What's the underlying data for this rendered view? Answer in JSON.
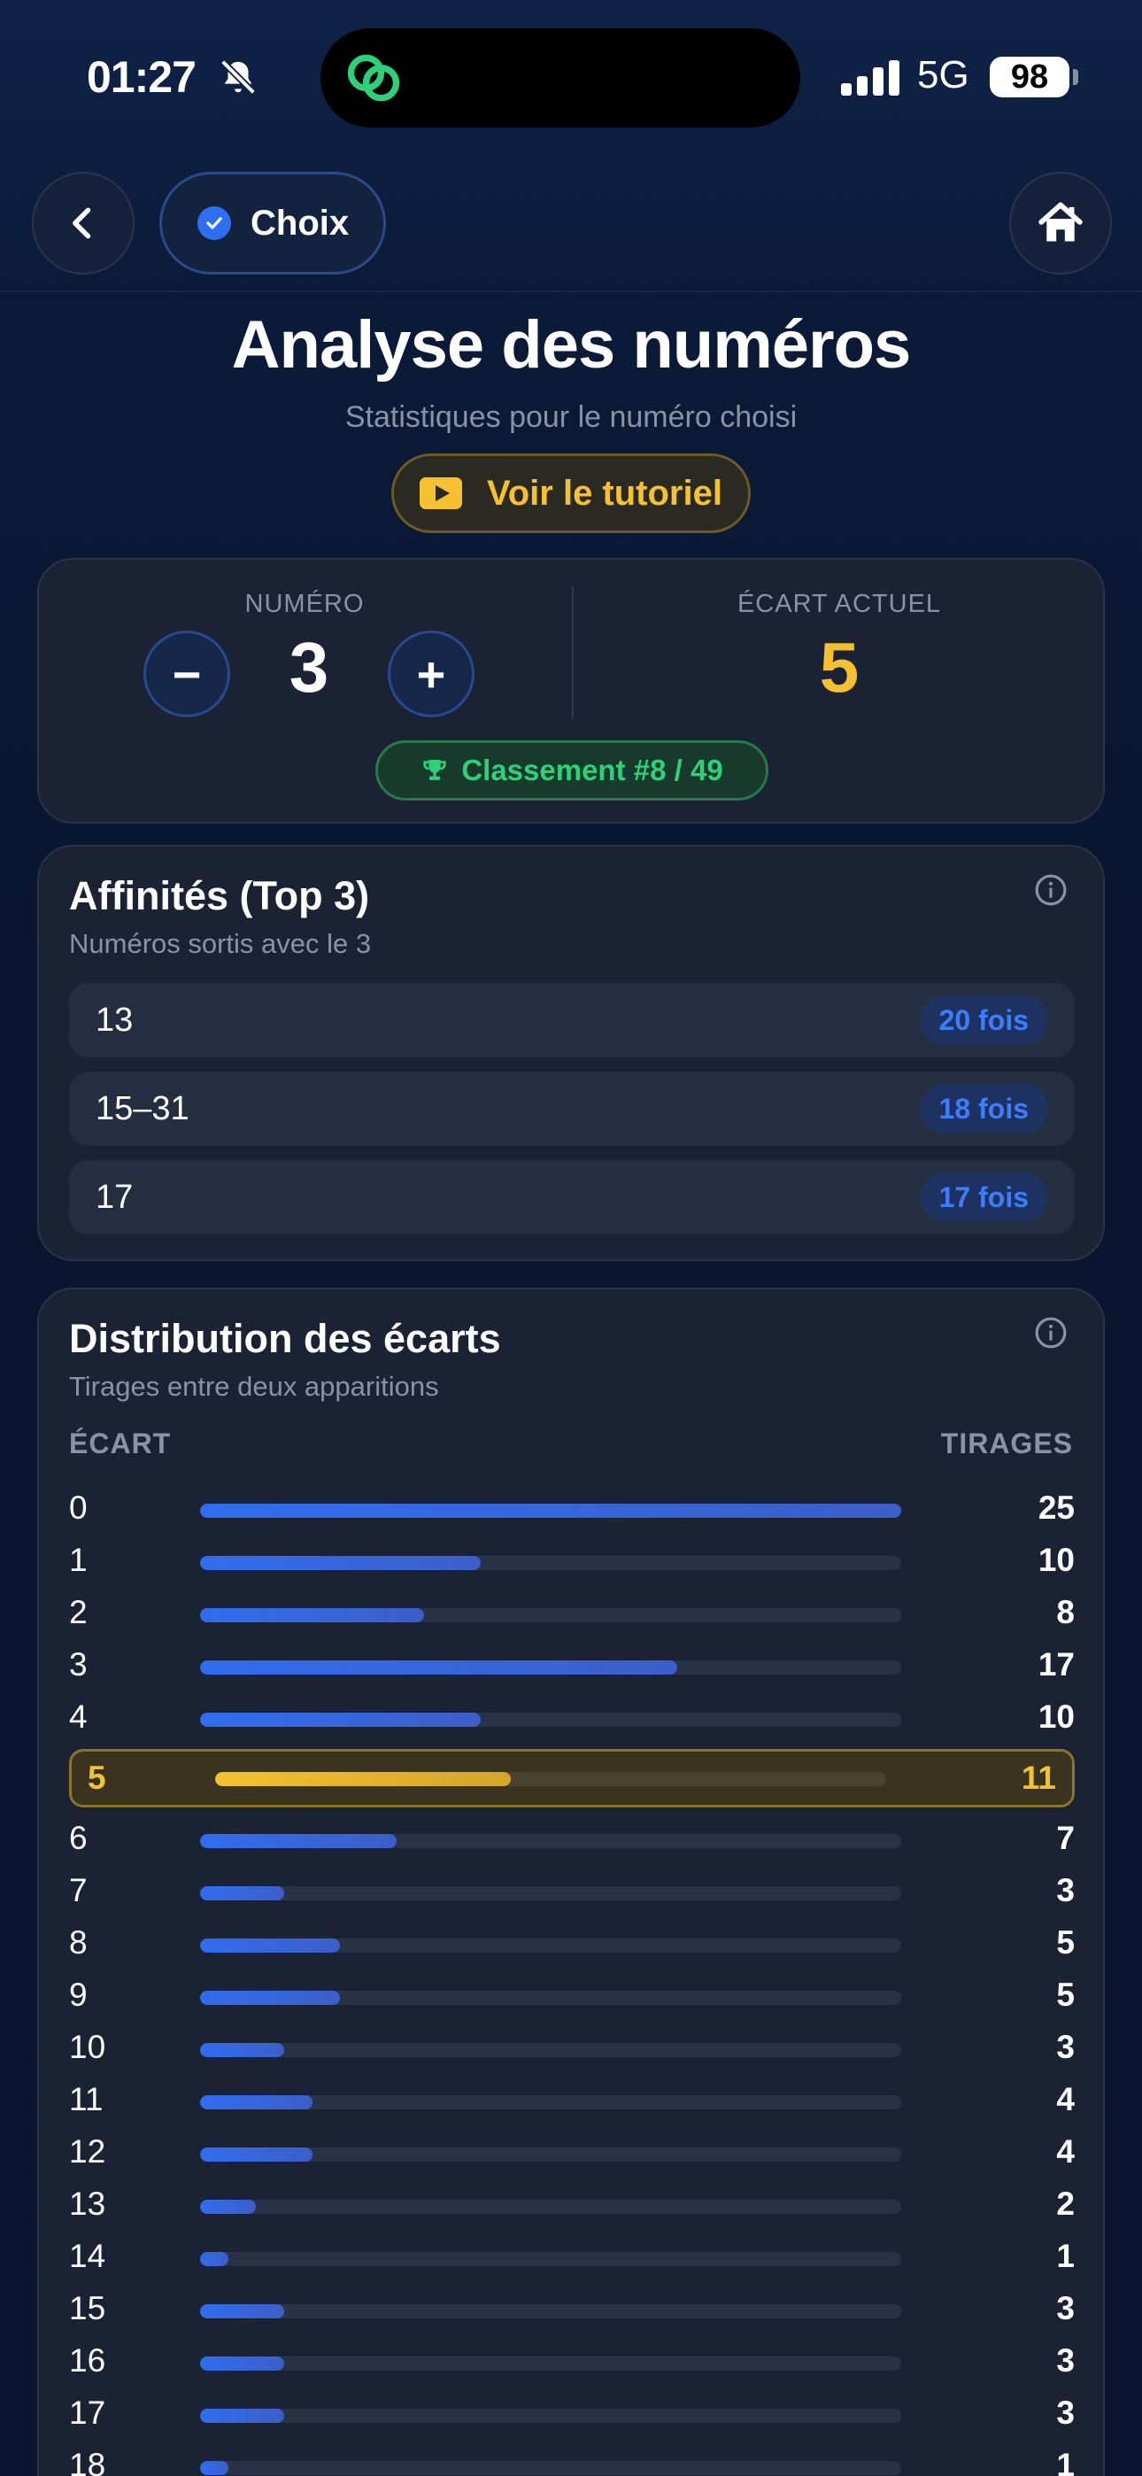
{
  "status_bar": {
    "time": "01:27",
    "network": "5G",
    "battery": "98"
  },
  "nav": {
    "choix_label": "Choix"
  },
  "header": {
    "title": "Analyse des numéros",
    "subtitle": "Statistiques pour le numéro choisi",
    "tutorial_label": "Voir le tutoriel"
  },
  "numero_card": {
    "numero_label": "NUMÉRO",
    "numero_value": "3",
    "minus_label": "−",
    "plus_label": "+",
    "ecart_label": "ÉCART ACTUEL",
    "ecart_value": "5",
    "rank_label": "Classement #8 / 49"
  },
  "affinities": {
    "title": "Affinités (Top 3)",
    "subtitle": "Numéros sortis avec le 3",
    "items": [
      {
        "numbers": "13",
        "count": "20 fois"
      },
      {
        "numbers": "15–31",
        "count": "18 fois"
      },
      {
        "numbers": "17",
        "count": "17 fois"
      }
    ]
  },
  "distribution": {
    "title": "Distribution des écarts",
    "subtitle": "Tirages entre deux apparitions",
    "col_ecart": "ÉCART",
    "col_tirages": "TIRAGES",
    "max": 25,
    "highlight_ecart": "5",
    "rows": [
      {
        "ecart": "0",
        "tirages": 25
      },
      {
        "ecart": "1",
        "tirages": 10
      },
      {
        "ecart": "2",
        "tirages": 8
      },
      {
        "ecart": "3",
        "tirages": 17
      },
      {
        "ecart": "4",
        "tirages": 10
      },
      {
        "ecart": "5",
        "tirages": 11
      },
      {
        "ecart": "6",
        "tirages": 7
      },
      {
        "ecart": "7",
        "tirages": 3
      },
      {
        "ecart": "8",
        "tirages": 5
      },
      {
        "ecart": "9",
        "tirages": 5
      },
      {
        "ecart": "10",
        "tirages": 3
      },
      {
        "ecart": "11",
        "tirages": 4
      },
      {
        "ecart": "12",
        "tirages": 4
      },
      {
        "ecart": "13",
        "tirages": 2
      },
      {
        "ecart": "14",
        "tirages": 1
      },
      {
        "ecart": "15",
        "tirages": 3
      },
      {
        "ecart": "16",
        "tirages": 3
      },
      {
        "ecart": "17",
        "tirages": 3
      },
      {
        "ecart": "18",
        "tirages": 1
      }
    ]
  },
  "colors": {
    "accent_blue": "#2e6ff2",
    "highlight_gold": "#f5c131",
    "rank_green": "#2fd07a"
  },
  "icons": [
    "bell-slash-icon",
    "app-link-icon",
    "signal-icon",
    "chevron-left-icon",
    "check-icon",
    "home-icon",
    "play-icon",
    "trophy-icon",
    "info-icon"
  ]
}
